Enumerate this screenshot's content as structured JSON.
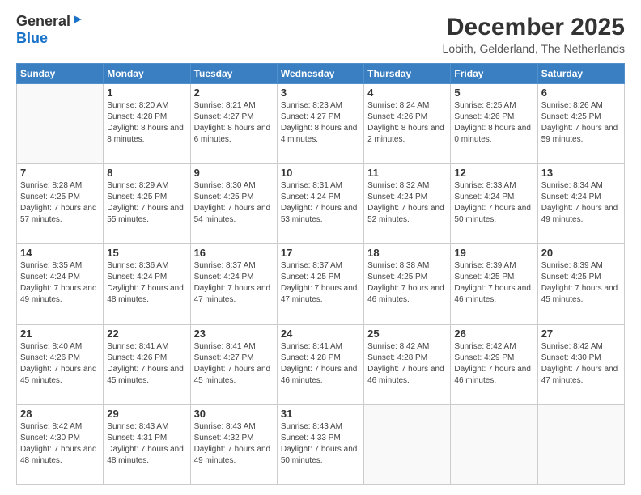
{
  "logo": {
    "line1": "General",
    "line2": "Blue"
  },
  "title": "December 2025",
  "subtitle": "Lobith, Gelderland, The Netherlands",
  "days_of_week": [
    "Sunday",
    "Monday",
    "Tuesday",
    "Wednesday",
    "Thursday",
    "Friday",
    "Saturday"
  ],
  "weeks": [
    [
      {
        "day": "",
        "sunrise": "",
        "sunset": "",
        "daylight": ""
      },
      {
        "day": "1",
        "sunrise": "Sunrise: 8:20 AM",
        "sunset": "Sunset: 4:28 PM",
        "daylight": "Daylight: 8 hours and 8 minutes."
      },
      {
        "day": "2",
        "sunrise": "Sunrise: 8:21 AM",
        "sunset": "Sunset: 4:27 PM",
        "daylight": "Daylight: 8 hours and 6 minutes."
      },
      {
        "day": "3",
        "sunrise": "Sunrise: 8:23 AM",
        "sunset": "Sunset: 4:27 PM",
        "daylight": "Daylight: 8 hours and 4 minutes."
      },
      {
        "day": "4",
        "sunrise": "Sunrise: 8:24 AM",
        "sunset": "Sunset: 4:26 PM",
        "daylight": "Daylight: 8 hours and 2 minutes."
      },
      {
        "day": "5",
        "sunrise": "Sunrise: 8:25 AM",
        "sunset": "Sunset: 4:26 PM",
        "daylight": "Daylight: 8 hours and 0 minutes."
      },
      {
        "day": "6",
        "sunrise": "Sunrise: 8:26 AM",
        "sunset": "Sunset: 4:25 PM",
        "daylight": "Daylight: 7 hours and 59 minutes."
      }
    ],
    [
      {
        "day": "7",
        "sunrise": "Sunrise: 8:28 AM",
        "sunset": "Sunset: 4:25 PM",
        "daylight": "Daylight: 7 hours and 57 minutes."
      },
      {
        "day": "8",
        "sunrise": "Sunrise: 8:29 AM",
        "sunset": "Sunset: 4:25 PM",
        "daylight": "Daylight: 7 hours and 55 minutes."
      },
      {
        "day": "9",
        "sunrise": "Sunrise: 8:30 AM",
        "sunset": "Sunset: 4:25 PM",
        "daylight": "Daylight: 7 hours and 54 minutes."
      },
      {
        "day": "10",
        "sunrise": "Sunrise: 8:31 AM",
        "sunset": "Sunset: 4:24 PM",
        "daylight": "Daylight: 7 hours and 53 minutes."
      },
      {
        "day": "11",
        "sunrise": "Sunrise: 8:32 AM",
        "sunset": "Sunset: 4:24 PM",
        "daylight": "Daylight: 7 hours and 52 minutes."
      },
      {
        "day": "12",
        "sunrise": "Sunrise: 8:33 AM",
        "sunset": "Sunset: 4:24 PM",
        "daylight": "Daylight: 7 hours and 50 minutes."
      },
      {
        "day": "13",
        "sunrise": "Sunrise: 8:34 AM",
        "sunset": "Sunset: 4:24 PM",
        "daylight": "Daylight: 7 hours and 49 minutes."
      }
    ],
    [
      {
        "day": "14",
        "sunrise": "Sunrise: 8:35 AM",
        "sunset": "Sunset: 4:24 PM",
        "daylight": "Daylight: 7 hours and 49 minutes."
      },
      {
        "day": "15",
        "sunrise": "Sunrise: 8:36 AM",
        "sunset": "Sunset: 4:24 PM",
        "daylight": "Daylight: 7 hours and 48 minutes."
      },
      {
        "day": "16",
        "sunrise": "Sunrise: 8:37 AM",
        "sunset": "Sunset: 4:24 PM",
        "daylight": "Daylight: 7 hours and 47 minutes."
      },
      {
        "day": "17",
        "sunrise": "Sunrise: 8:37 AM",
        "sunset": "Sunset: 4:25 PM",
        "daylight": "Daylight: 7 hours and 47 minutes."
      },
      {
        "day": "18",
        "sunrise": "Sunrise: 8:38 AM",
        "sunset": "Sunset: 4:25 PM",
        "daylight": "Daylight: 7 hours and 46 minutes."
      },
      {
        "day": "19",
        "sunrise": "Sunrise: 8:39 AM",
        "sunset": "Sunset: 4:25 PM",
        "daylight": "Daylight: 7 hours and 46 minutes."
      },
      {
        "day": "20",
        "sunrise": "Sunrise: 8:39 AM",
        "sunset": "Sunset: 4:25 PM",
        "daylight": "Daylight: 7 hours and 45 minutes."
      }
    ],
    [
      {
        "day": "21",
        "sunrise": "Sunrise: 8:40 AM",
        "sunset": "Sunset: 4:26 PM",
        "daylight": "Daylight: 7 hours and 45 minutes."
      },
      {
        "day": "22",
        "sunrise": "Sunrise: 8:41 AM",
        "sunset": "Sunset: 4:26 PM",
        "daylight": "Daylight: 7 hours and 45 minutes."
      },
      {
        "day": "23",
        "sunrise": "Sunrise: 8:41 AM",
        "sunset": "Sunset: 4:27 PM",
        "daylight": "Daylight: 7 hours and 45 minutes."
      },
      {
        "day": "24",
        "sunrise": "Sunrise: 8:41 AM",
        "sunset": "Sunset: 4:28 PM",
        "daylight": "Daylight: 7 hours and 46 minutes."
      },
      {
        "day": "25",
        "sunrise": "Sunrise: 8:42 AM",
        "sunset": "Sunset: 4:28 PM",
        "daylight": "Daylight: 7 hours and 46 minutes."
      },
      {
        "day": "26",
        "sunrise": "Sunrise: 8:42 AM",
        "sunset": "Sunset: 4:29 PM",
        "daylight": "Daylight: 7 hours and 46 minutes."
      },
      {
        "day": "27",
        "sunrise": "Sunrise: 8:42 AM",
        "sunset": "Sunset: 4:30 PM",
        "daylight": "Daylight: 7 hours and 47 minutes."
      }
    ],
    [
      {
        "day": "28",
        "sunrise": "Sunrise: 8:42 AM",
        "sunset": "Sunset: 4:30 PM",
        "daylight": "Daylight: 7 hours and 48 minutes."
      },
      {
        "day": "29",
        "sunrise": "Sunrise: 8:43 AM",
        "sunset": "Sunset: 4:31 PM",
        "daylight": "Daylight: 7 hours and 48 minutes."
      },
      {
        "day": "30",
        "sunrise": "Sunrise: 8:43 AM",
        "sunset": "Sunset: 4:32 PM",
        "daylight": "Daylight: 7 hours and 49 minutes."
      },
      {
        "day": "31",
        "sunrise": "Sunrise: 8:43 AM",
        "sunset": "Sunset: 4:33 PM",
        "daylight": "Daylight: 7 hours and 50 minutes."
      },
      {
        "day": "",
        "sunrise": "",
        "sunset": "",
        "daylight": ""
      },
      {
        "day": "",
        "sunrise": "",
        "sunset": "",
        "daylight": ""
      },
      {
        "day": "",
        "sunrise": "",
        "sunset": "",
        "daylight": ""
      }
    ]
  ]
}
